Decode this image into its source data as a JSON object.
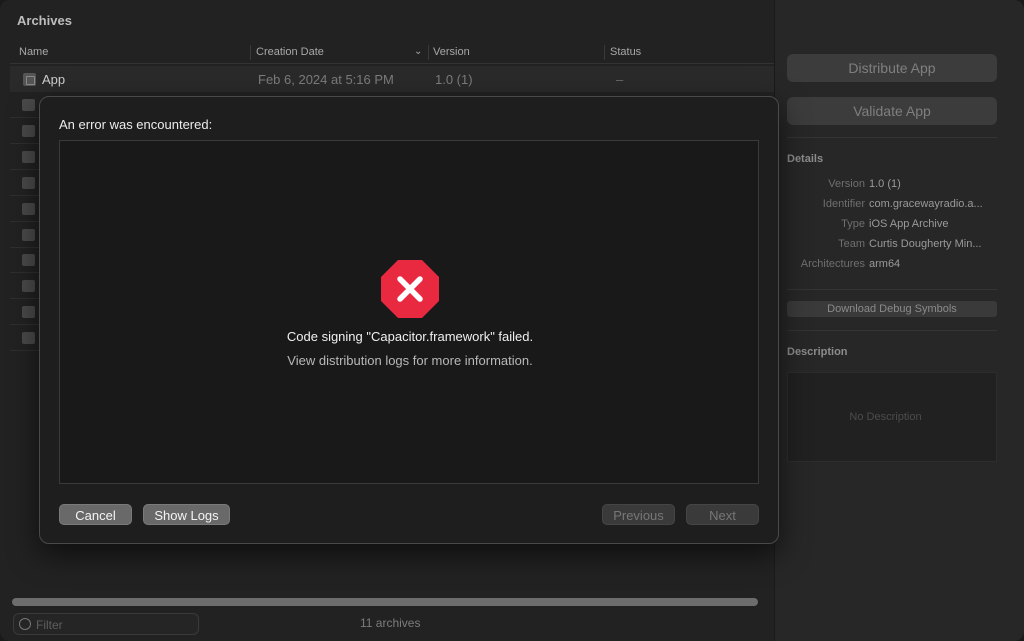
{
  "window": {
    "title": "Archives"
  },
  "table": {
    "columns": [
      "Name",
      "Creation Date",
      "Version",
      "Status"
    ],
    "selected_row": {
      "name": "App",
      "date": "Feb 6, 2024 at 5:16 PM",
      "version": "1.0 (1)",
      "status": "–"
    }
  },
  "filter": {
    "placeholder": "Filter"
  },
  "footer": {
    "count": "11 archives"
  },
  "sidebar": {
    "distribute": "Distribute App",
    "validate": "Validate App",
    "details_title": "Details",
    "details": [
      {
        "label": "Version",
        "value": "1.0 (1)"
      },
      {
        "label": "Identifier",
        "value": "com.gracewayradio.a..."
      },
      {
        "label": "Type",
        "value": "iOS App Archive"
      },
      {
        "label": "Team",
        "value": "Curtis Dougherty Min..."
      },
      {
        "label": "Architectures",
        "value": "arm64"
      }
    ],
    "debug_button": "Download Debug Symbols",
    "description_title": "Description",
    "description_empty": "No Description"
  },
  "dialog": {
    "title": "An error was encountered:",
    "message": "Code signing \"Capacitor.framework\" failed.",
    "submessage": "View distribution logs for more information.",
    "cancel": "Cancel",
    "show_logs": "Show Logs",
    "previous": "Previous",
    "next": "Next"
  },
  "colors": {
    "error_red": "#e8293f",
    "accent_bg": "#232222"
  }
}
